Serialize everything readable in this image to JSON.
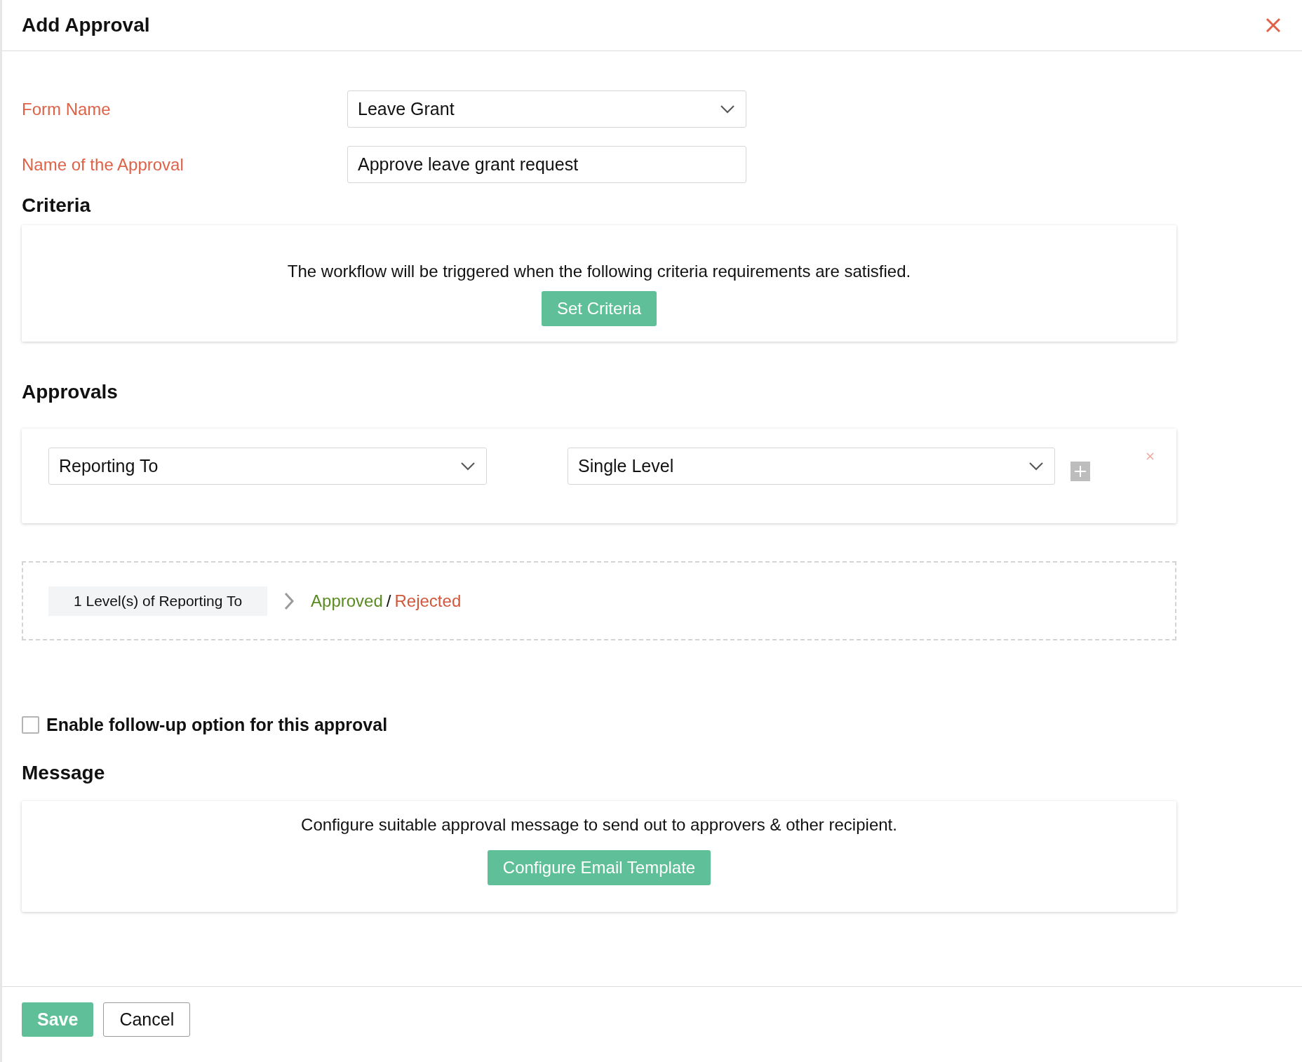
{
  "window": {
    "title": "Add Approval"
  },
  "fields": [
    {
      "label": "Form Name",
      "value": "Leave Grant",
      "kind": "select"
    },
    {
      "label": "Name of the Approval",
      "value": "Approve leave grant request",
      "kind": "text"
    }
  ],
  "criteria": {
    "heading": "Criteria",
    "description": "The workflow will be triggered when the following criteria requirements are satisfied.",
    "button": "Set Criteria"
  },
  "approvals": {
    "heading": "Approvals",
    "rows": [
      {
        "approver": "Reporting To",
        "levels": "Single Level"
      }
    ],
    "summary": {
      "step": "1 Level(s) of Reporting To",
      "approved": "Approved",
      "separator": "/",
      "rejected": "Rejected"
    }
  },
  "follow_up": {
    "label": "Enable follow-up option for this approval",
    "checked": false
  },
  "message": {
    "heading": "Message",
    "description": "Configure suitable approval message to send out to approvers & other recipient.",
    "button": "Configure Email Template"
  },
  "footer": [
    {
      "label": "Save",
      "kind": "primary"
    },
    {
      "label": "Cancel",
      "kind": "secondary"
    }
  ]
}
